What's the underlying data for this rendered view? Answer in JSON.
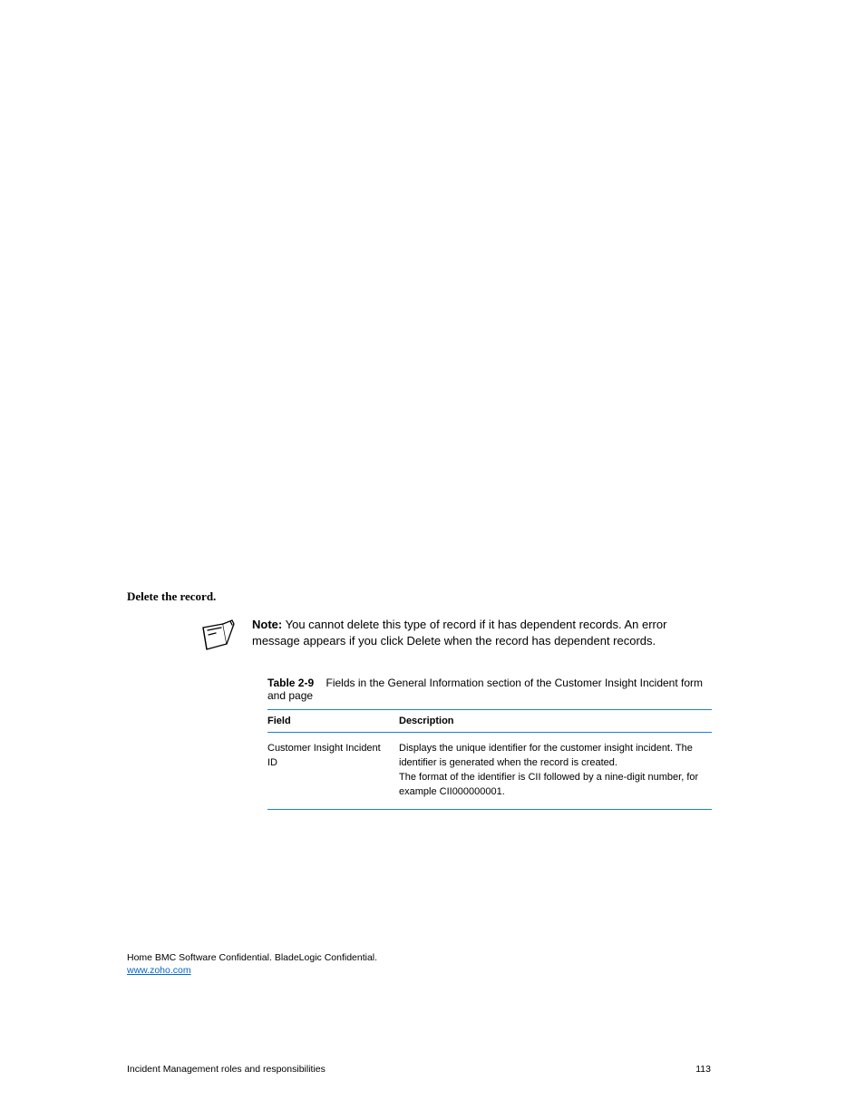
{
  "section": {
    "heading": "Delete the record.",
    "note_label": "Note:",
    "note_body": "You cannot delete this type of record if it has dependent records. An error message appears if you click Delete when the record has dependent records."
  },
  "table": {
    "caption_prefix": "Table 2-9",
    "caption_body": "Fields in the General Information section of the Customer Insight Incident form and page",
    "columns": [
      "Field",
      "Description"
    ],
    "rows": [
      {
        "field": "Customer Insight Incident ID",
        "desc": "Displays the unique identifier for the customer insight incident. The identifier is generated when the record is created.\nThe format of the identifier is CII followed by a nine-digit number, for example CII000000001."
      }
    ]
  },
  "running_head": {
    "line1": "Home  BMC Software Confidential. BladeLogic Confidential.",
    "url_text": "www.zoho.com"
  },
  "footer": {
    "left": "Incident Management roles and responsibilities",
    "right": "113"
  }
}
